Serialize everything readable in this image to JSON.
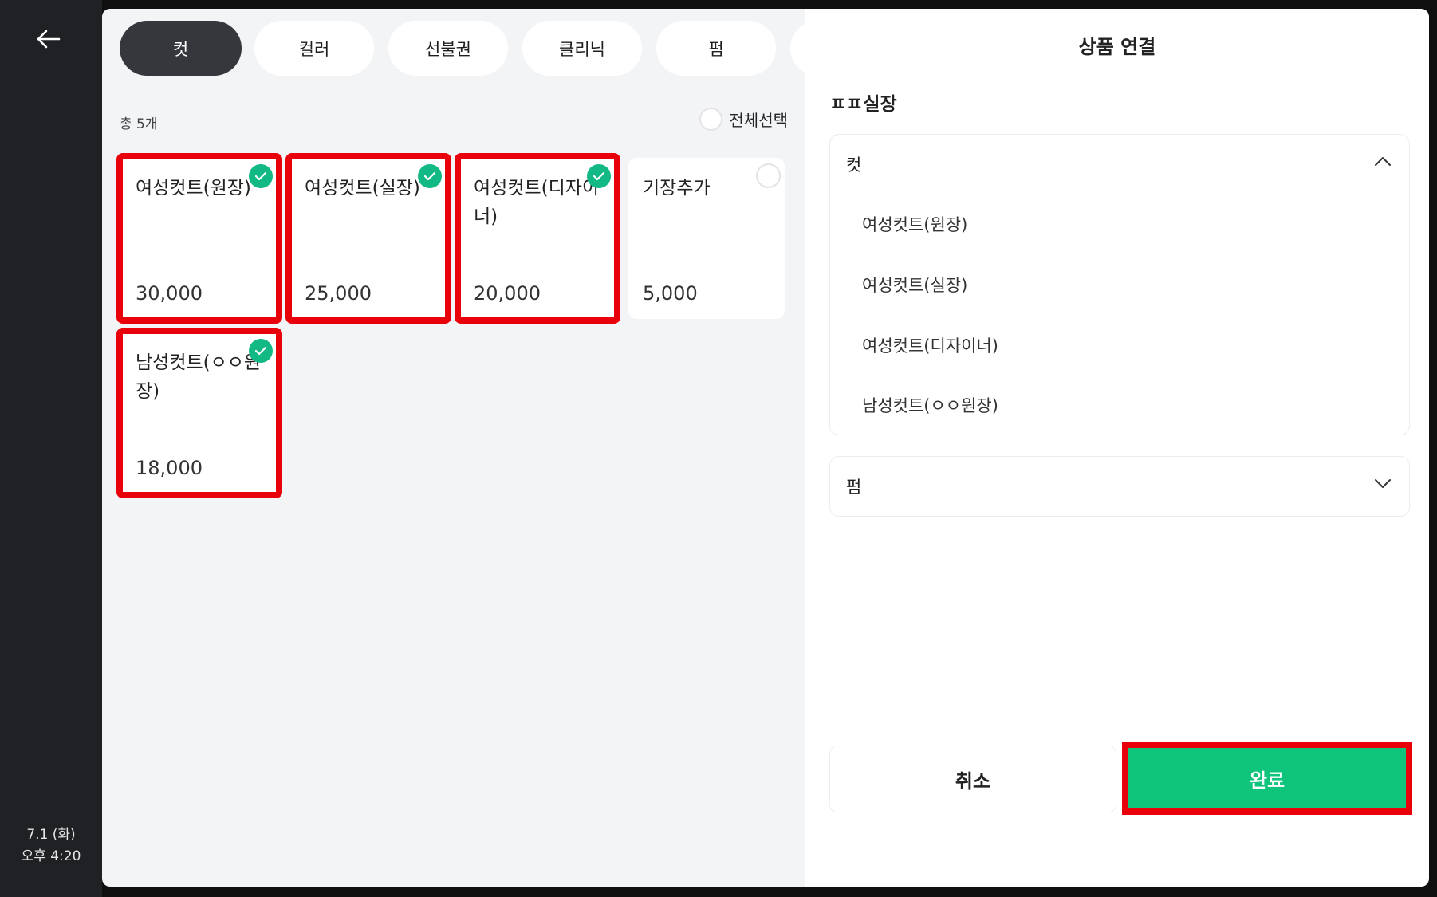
{
  "rail": {
    "back_icon": "arrow-left-icon",
    "date": "7.1 (화)",
    "time": "오후 4:20"
  },
  "tabs": [
    {
      "label": "컷",
      "active": true
    },
    {
      "label": "컬러",
      "active": false
    },
    {
      "label": "선불권",
      "active": false
    },
    {
      "label": "클리닉",
      "active": false
    },
    {
      "label": "펌",
      "active": false
    }
  ],
  "list": {
    "count_label": "총 5개",
    "select_all_label": "전체선택"
  },
  "products": [
    {
      "name": "여성컷트(원장)",
      "price": "30,000",
      "selected": true
    },
    {
      "name": "여성컷트(실장)",
      "price": "25,000",
      "selected": true
    },
    {
      "name": "여성컷트(디자이너)",
      "price": "20,000",
      "selected": true
    },
    {
      "name": "기장추가",
      "price": "5,000",
      "selected": false
    },
    {
      "name": "남성컷트(ㅇㅇ원장)",
      "price": "18,000",
      "selected": true
    }
  ],
  "panel": {
    "title": "상품 연결",
    "staff_name": "ㅍㅍ실장",
    "groups": [
      {
        "label": "컷",
        "expanded": true,
        "items": [
          "여성컷트(원장)",
          "여성컷트(실장)",
          "여성컷트(디자이너)",
          "남성컷트(ㅇㅇ원장)"
        ]
      },
      {
        "label": "펌",
        "expanded": false,
        "items": []
      }
    ],
    "cancel_label": "취소",
    "done_label": "완료"
  },
  "colors": {
    "accent_green": "#0fc47b",
    "check_green": "#13b985",
    "highlight_red": "#e8000b",
    "active_tab": "#36373c"
  }
}
